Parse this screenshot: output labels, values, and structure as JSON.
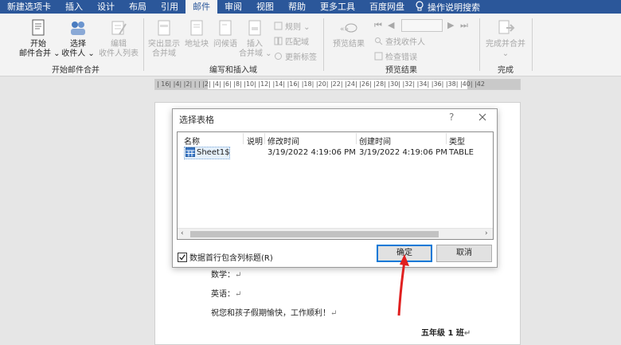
{
  "tabs": [
    {
      "label": "新建选项卡",
      "active": false
    },
    {
      "label": "插入",
      "active": false
    },
    {
      "label": "设计",
      "active": false
    },
    {
      "label": "布局",
      "active": false
    },
    {
      "label": "引用",
      "active": false
    },
    {
      "label": "邮件",
      "active": true
    },
    {
      "label": "审阅",
      "active": false
    },
    {
      "label": "视图",
      "active": false
    },
    {
      "label": "帮助",
      "active": false
    },
    {
      "label": "更多工具",
      "active": false
    },
    {
      "label": "百度网盘",
      "active": false
    }
  ],
  "tell_me": "操作说明搜索",
  "ribbon": {
    "group_start": {
      "label": "开始邮件合并",
      "start_merge": "开始\n邮件合并 ⌄",
      "select_recipients": "选择\n收件人 ⌄",
      "edit_recipients": "编辑\n收件人列表"
    },
    "group_write": {
      "label": "编写和插入域",
      "highlight": "突出显示\n合并域",
      "address_block": "地址块",
      "greeting": "问候语",
      "insert_field": "插入\n合并域 ⌄",
      "rules": "规则 ⌄",
      "match_fields": "匹配域",
      "update_labels": "更新标签"
    },
    "group_preview": {
      "label": "预览结果",
      "preview": "预览结果",
      "find_recipient": "查找收件人",
      "check_errors": "检查错误"
    },
    "group_finish": {
      "label": "完成",
      "finish_merge": "完成并合并\n⌄"
    }
  },
  "ruler_text": "| 16| |4| |2| | | |2| |4| |6| |8| |10| |12| |14| |16| |18| |20| |22| |24| |26| |28| |30| |32| |34| |36| |38| |40| |42",
  "document": {
    "line_math": "数学：",
    "line_english": "英语：",
    "line_wish": "祝您和孩子假期愉快，工作顺利！",
    "line_class": "五年级 1 班",
    "para_mark": "↵"
  },
  "dialog": {
    "title": "选择表格",
    "help": "?",
    "columns": {
      "name": "名称",
      "desc": "说明",
      "modified": "修改时间",
      "created": "创建时间",
      "type": "类型"
    },
    "rows": [
      {
        "name": "Sheet1$",
        "desc": "",
        "modified": "3/19/2022 4:19:06 PM",
        "created": "3/19/2022 4:19:06 PM",
        "type": "TABLE"
      }
    ],
    "checkbox_label": "数据首行包含列标题(R)",
    "checkbox_checked": true,
    "ok": "确定",
    "cancel": "取消"
  },
  "colors": {
    "accent": "#2b579a",
    "focus": "#0078d7",
    "annotation": "#e02020"
  }
}
